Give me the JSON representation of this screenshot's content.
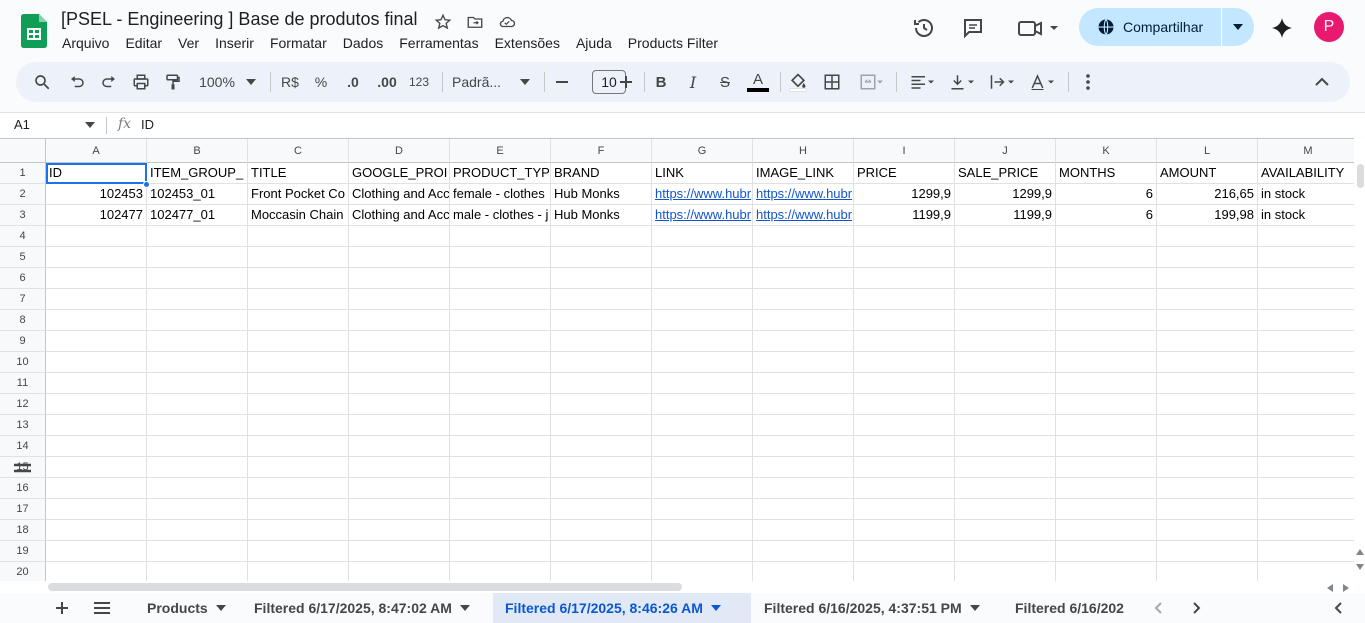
{
  "app": {
    "doc_title": "[PSEL - Engineering ] Base de produtos final",
    "menu": [
      "Arquivo",
      "Editar",
      "Ver",
      "Inserir",
      "Formatar",
      "Dados",
      "Ferramentas",
      "Extensões",
      "Ajuda",
      "Products Filter"
    ],
    "share_label": "Compartilhar",
    "avatar_letter": "P"
  },
  "toolbar": {
    "zoom": "100%",
    "currency": "R$",
    "percent": "%",
    "dec_decrease": ".0",
    "dec_increase": ".00",
    "number_format": "123",
    "font": "Padrã...",
    "font_size": "10",
    "bold": "B",
    "italic": "I",
    "strike": "S",
    "text_color": "A"
  },
  "formula_bar": {
    "cell_ref": "A1",
    "fx": "fx",
    "value": "ID"
  },
  "grid": {
    "columns": [
      "A",
      "B",
      "C",
      "D",
      "E",
      "F",
      "G",
      "H",
      "I",
      "J",
      "K",
      "L",
      "M"
    ],
    "row_numbers": [
      "1",
      "2",
      "3",
      "4",
      "5",
      "6",
      "7",
      "8",
      "9",
      "10",
      "11",
      "12",
      "13",
      "14",
      "15",
      "16",
      "17",
      "18",
      "19",
      "20"
    ],
    "header_row": [
      "ID",
      "ITEM_GROUP_",
      "TITLE",
      "GOOGLE_PROI",
      "PRODUCT_TYP",
      "BRAND",
      "LINK",
      "IMAGE_LINK",
      "PRICE",
      "SALE_PRICE",
      "MONTHS",
      "AMOUNT",
      "AVAILABILITY"
    ],
    "rows": [
      [
        "102453",
        "102453_01",
        "Front Pocket Co",
        "Clothing and Acc",
        "female - clothes",
        "Hub Monks",
        "https://www.hubr",
        "https://www.hubr",
        "1299,9",
        "1299,9",
        "6",
        "216,65",
        "in stock"
      ],
      [
        "102477",
        "102477_01",
        "Moccasin Chain",
        "Clothing and Acc",
        "male - clothes - j",
        "Hub Monks",
        "https://www.hubr",
        "https://www.hubr",
        "1199,9",
        "1199,9",
        "6",
        "199,98",
        "in stock"
      ]
    ]
  },
  "sheets": {
    "tabs": [
      {
        "label": "Products"
      },
      {
        "label": "Filtered 6/17/2025, 8:47:02 AM"
      },
      {
        "label": "Filtered 6/17/2025, 8:46:26 AM"
      },
      {
        "label": "Filtered 6/16/2025, 4:37:51 PM"
      },
      {
        "label": "Filtered 6/16/202"
      }
    ],
    "active_index": 2
  },
  "colors": {
    "accent": "#0b57d0",
    "share_bg": "#c2e7ff",
    "avatar": "#e8196f",
    "selection": "#1a73e8",
    "link": "#1155cc"
  }
}
